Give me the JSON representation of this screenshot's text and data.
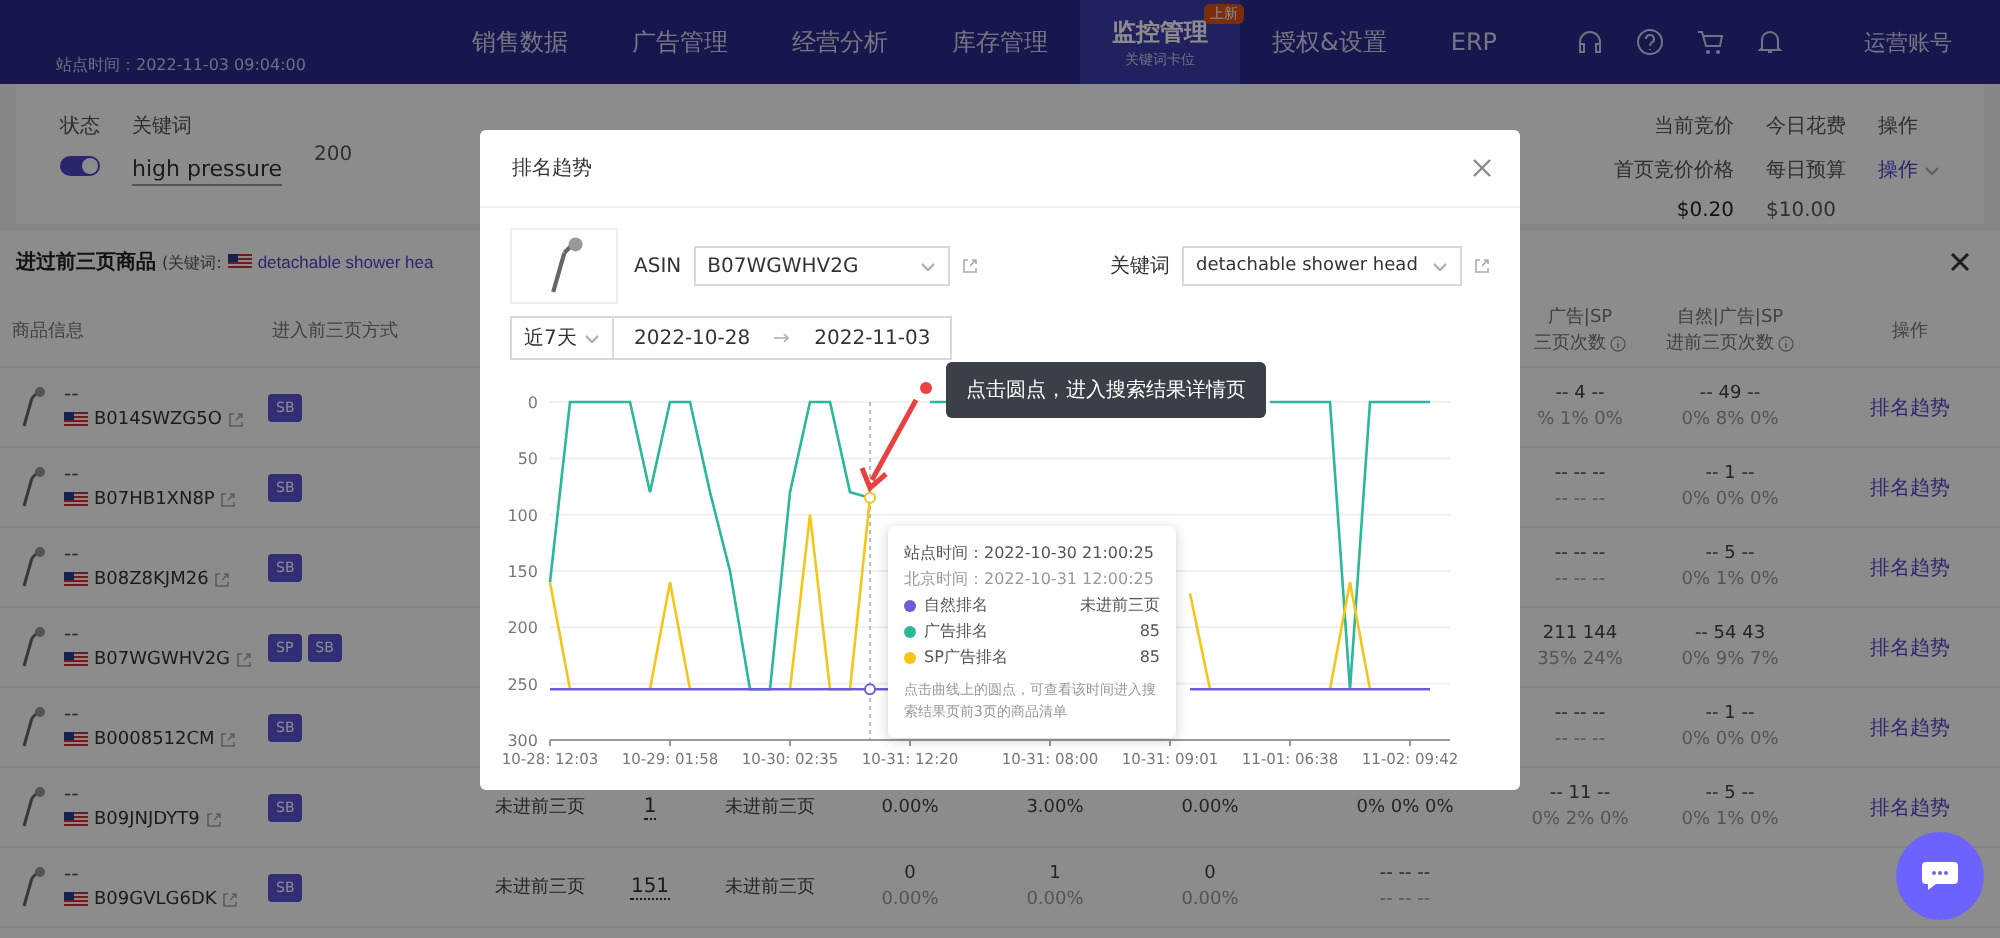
{
  "nav": {
    "subtitle": "站点时间：2022-11-03 09:04:00",
    "items": [
      {
        "label": "销售数据",
        "selected": false
      },
      {
        "label": "广告管理",
        "selected": false
      },
      {
        "label": "经营分析",
        "selected": false
      },
      {
        "label": "库存管理",
        "selected": false
      },
      {
        "label": "监控管理",
        "selected": true,
        "badge": "上新",
        "sub": "关键词卡位"
      },
      {
        "label": "授权&设置",
        "selected": false
      },
      {
        "label": "ERP",
        "selected": false
      }
    ],
    "account": "运营账号"
  },
  "filter": {
    "status_label": "状态",
    "keyword_label": "关键词",
    "enabled": true,
    "keyword": "high pressure",
    "value": "200",
    "bid_label": "当前竞价",
    "bid_sub": "首页竞价价格",
    "bid": "$0.20",
    "spend_label": "今日花费",
    "spend_sub": "每日预算",
    "spend": "$10.00",
    "action_label": "操作",
    "action": "操作"
  },
  "drawer": {
    "title": "进过前三页商品",
    "keyword_prefix": "(关键词:",
    "keyword": "detachable shower hea",
    "columns": [
      "商品信息",
      "进入前三页方式"
    ],
    "right_columns": [
      {
        "line1": "广告|SP",
        "line2": "三页次数"
      },
      {
        "line1": "自然|广告|SP",
        "line2": "进前三页次数"
      },
      {
        "line1": "操作"
      }
    ],
    "rows": [
      {
        "title": "--",
        "asin": "B014SWZG5O",
        "methods": [
          "SB"
        ],
        "cells": [
          null,
          null,
          null,
          null,
          null,
          null,
          null,
          {
            "kind": "text",
            "lines": [
              "-- 4 --",
              "% 1% 0%"
            ]
          },
          {
            "kind": "text",
            "lines": [
              "-- 49 --",
              "0% 8% 0%"
            ]
          }
        ],
        "action": "排名趋势"
      },
      {
        "title": "--",
        "asin": "B07HB1XN8P",
        "methods": [
          "SB"
        ],
        "cells": [
          null,
          null,
          null,
          null,
          null,
          null,
          null,
          {
            "kind": "text",
            "lines": [
              "-- -- --",
              "-- -- --"
            ]
          },
          {
            "kind": "text",
            "lines": [
              "-- 1 --",
              "0% 0% 0%"
            ]
          }
        ],
        "action": "排名趋势"
      },
      {
        "title": "--",
        "asin": "B08Z8KJM26",
        "methods": [
          "SB"
        ],
        "cells": [
          null,
          null,
          null,
          null,
          null,
          null,
          null,
          {
            "kind": "text",
            "lines": [
              "-- -- --",
              "-- -- --"
            ]
          },
          {
            "kind": "text",
            "lines": [
              "-- 5 --",
              "0% 1% 0%"
            ]
          }
        ],
        "action": "排名趋势"
      },
      {
        "title": "--",
        "asin": "B07WGWHV2G",
        "methods": [
          "SP",
          "SB"
        ],
        "cells": [
          null,
          null,
          null,
          null,
          null,
          null,
          null,
          {
            "kind": "text",
            "lines": [
              "211 144",
              "35% 24%"
            ]
          },
          {
            "kind": "text",
            "lines": [
              "-- 54 43",
              "0% 9% 7%"
            ]
          }
        ],
        "action": "排名趋势"
      },
      {
        "title": "--",
        "asin": "B0008512CM",
        "methods": [
          "SB"
        ],
        "cells": [
          null,
          null,
          null,
          null,
          null,
          null,
          null,
          {
            "kind": "text",
            "lines": [
              "-- -- --",
              "-- -- --"
            ]
          },
          {
            "kind": "text",
            "lines": [
              "-- 1 --",
              "0% 0% 0%"
            ]
          }
        ],
        "action": "排名趋势"
      },
      {
        "title": "--",
        "asin": "B09JNJDYT9",
        "methods": [
          "SB"
        ],
        "cells": [
          {
            "kind": "text",
            "lines": [
              "未进前三页"
            ]
          },
          {
            "kind": "rank",
            "lines": [
              "1"
            ]
          },
          {
            "kind": "text",
            "lines": [
              "未进前三页"
            ]
          },
          {
            "kind": "text",
            "lines": [
              "0.00%"
            ]
          },
          {
            "kind": "text",
            "lines": [
              "3.00%"
            ]
          },
          {
            "kind": "text",
            "lines": [
              "0.00%"
            ]
          },
          {
            "kind": "text",
            "lines": [
              "0% 0% 0%"
            ]
          },
          {
            "kind": "text",
            "lines": [
              "-- 11 --",
              "0% 2% 0%"
            ]
          },
          {
            "kind": "text",
            "lines": [
              "-- 5 --",
              "0% 1% 0%"
            ]
          }
        ],
        "action": "排名趋势"
      },
      {
        "title": "--",
        "asin": "B09GVLG6DK",
        "methods": [
          "SB"
        ],
        "cells": [
          {
            "kind": "text",
            "lines": [
              "未进前三页"
            ]
          },
          {
            "kind": "rank",
            "lines": [
              "151"
            ]
          },
          {
            "kind": "text",
            "lines": [
              "未进前三页"
            ]
          },
          {
            "kind": "text",
            "lines": [
              "0",
              "0.00%"
            ]
          },
          {
            "kind": "text",
            "lines": [
              "1",
              "0.00%"
            ]
          },
          {
            "kind": "text",
            "lines": [
              "0",
              "0.00%"
            ]
          },
          {
            "kind": "text",
            "lines": [
              "-- -- --",
              "-- -- --"
            ]
          },
          null,
          null
        ]
      }
    ]
  },
  "modal": {
    "title": "排名趋势",
    "asin_label": "ASIN",
    "asin": "B07WGWHV2G",
    "keyword_label": "关键词",
    "keyword": "detachable shower head",
    "period": "近7天",
    "date_from": "2022-10-28",
    "date_to": "2022-11-03",
    "callout": "点击圆点，进入搜索结果详情页",
    "tooltip": {
      "site_time": "站点时间：2022-10-30 21:00:25",
      "beijing_time": "北京时间：2022-10-31 12:00:25",
      "values": [
        "未进前三页",
        "85",
        "85"
      ],
      "hint": "点击曲线上的圆点，可查看该时间进入搜索结果页前3页的商品清单"
    },
    "chart_data": {
      "type": "line",
      "grid": true,
      "categories": [
        "10-28: 12:03",
        null,
        null,
        null,
        null,
        null,
        "10-29: 01:58",
        null,
        null,
        null,
        null,
        null,
        "10-30: 02:35",
        null,
        null,
        null,
        null,
        null,
        "10-31: 12:20",
        null,
        null,
        null,
        null,
        null,
        null,
        "10-31: 08:00",
        null,
        null,
        null,
        null,
        null,
        "10-31: 09:01",
        null,
        null,
        null,
        null,
        null,
        "11-01: 06:38",
        null,
        null,
        null,
        null,
        null,
        "11-02: 09:42",
        null
      ],
      "yticks": [
        0,
        50,
        100,
        150,
        200,
        250,
        300
      ],
      "ylim": [
        300,
        0
      ],
      "series": [
        {
          "name": "自然排名",
          "color": "#6a5fd6",
          "values": [
            255,
            255,
            255,
            255,
            255,
            255,
            255,
            255,
            255,
            255,
            255,
            255,
            255,
            255,
            255,
            255,
            255,
            255,
            null,
            null,
            null,
            null,
            null,
            null,
            null,
            null,
            null,
            null,
            null,
            null,
            null,
            null,
            255,
            255,
            255,
            255,
            255,
            255,
            255,
            255,
            255,
            255,
            255,
            255,
            255
          ]
        },
        {
          "name": "广告排名",
          "color": "#2bb89a",
          "values": [
            160,
            0,
            0,
            0,
            0,
            80,
            0,
            0,
            80,
            150,
            255,
            255,
            80,
            0,
            0,
            80,
            85,
            null,
            null,
            0,
            0,
            null,
            null,
            null,
            null,
            null,
            null,
            null,
            null,
            null,
            null,
            null,
            null,
            null,
            null,
            null,
            0,
            0,
            0,
            0,
            255,
            0,
            0,
            0,
            0
          ]
        },
        {
          "name": "SP广告排名",
          "color": "#f5c518",
          "values": [
            160,
            255,
            null,
            null,
            null,
            255,
            160,
            255,
            null,
            null,
            null,
            null,
            255,
            100,
            255,
            255,
            85,
            null,
            null,
            null,
            null,
            null,
            null,
            null,
            null,
            null,
            null,
            null,
            null,
            null,
            null,
            null,
            170,
            255,
            null,
            null,
            null,
            null,
            null,
            255,
            160,
            255,
            null,
            null,
            null
          ]
        }
      ]
    }
  }
}
